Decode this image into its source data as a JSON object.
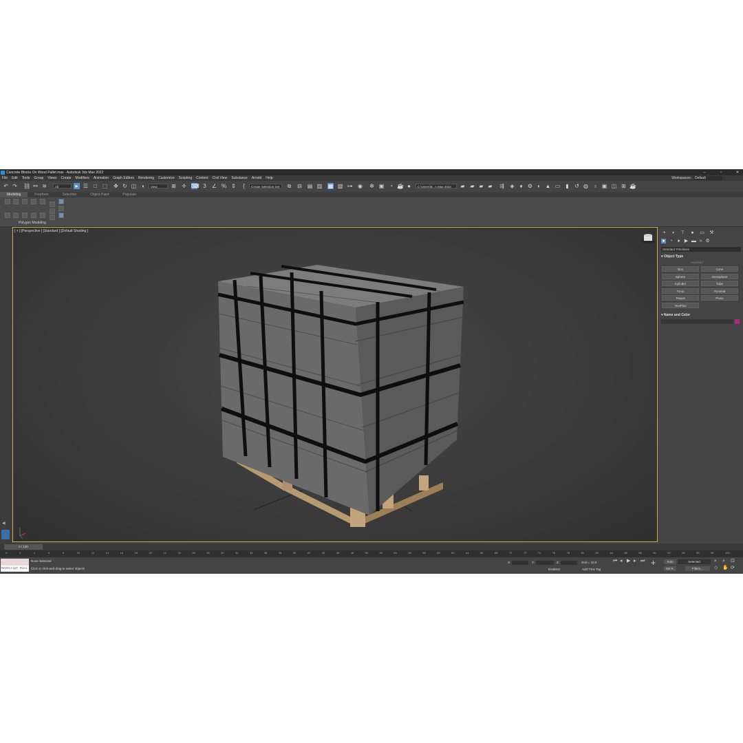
{
  "window": {
    "title": "Concrete Blocks On Wood Pallet.max - Autodesk 3ds Max 2022",
    "workspace_label": "Workspaces:",
    "workspace_value": "Default"
  },
  "menu": [
    "File",
    "Edit",
    "Tools",
    "Group",
    "Views",
    "Create",
    "Modifiers",
    "Animation",
    "Graph Editors",
    "Rendering",
    "Customize",
    "Scripting",
    "Content",
    "Civil View",
    "Substance",
    "Arnold",
    "Help"
  ],
  "toolbar": {
    "filter_value": "All",
    "view_value": "View",
    "selection_set": "Create Selection Set",
    "project_path": "C:\\Users\\B...s Max 2022"
  },
  "ribbon": {
    "tabs": [
      "Modeling",
      "Freeform",
      "Selection",
      "Object Paint",
      "Populate"
    ],
    "panel_label": "Polygon Modeling"
  },
  "viewport": {
    "label": "[ + ] [Perspective ] [Standard ] [Default Shading ]"
  },
  "command_panel": {
    "category": "Standard Primitives",
    "object_type_title": "Object Type",
    "autogrid": "AutoGrid",
    "buttons": [
      "Box",
      "Cone",
      "Sphere",
      "GeoSphere",
      "Cylinder",
      "Tube",
      "Torus",
      "Pyramid",
      "Teapot",
      "Plane",
      "TextPlus"
    ],
    "name_color_title": "Name and Color",
    "swatch_color": "#b0248a"
  },
  "timeline": {
    "frame_display": "0 / 100",
    "ticks": [
      "0",
      "2",
      "6",
      "8",
      "10",
      "12",
      "14",
      "16",
      "18",
      "20",
      "22",
      "24",
      "26",
      "28",
      "30",
      "32",
      "34",
      "36",
      "38",
      "40",
      "42",
      "44",
      "46",
      "48",
      "50",
      "52",
      "54",
      "56",
      "58",
      "60",
      "62",
      "64",
      "66",
      "68",
      "70",
      "72",
      "74",
      "76",
      "78",
      "80",
      "82",
      "84",
      "86",
      "88",
      "90",
      "92",
      "94",
      "96",
      "98",
      "100"
    ]
  },
  "status": {
    "maxscript": "MAXScript Mini",
    "selection": "None Selected",
    "prompt": "Click or click-and-drag to select objects",
    "x_label": "X:",
    "y_label": "Y:",
    "z_label": "Z:",
    "grid": "Grid = 10,0",
    "enabled": "Enabled:",
    "add_time_tag": "Add Time Tag",
    "auto": "Auto",
    "selected": "Selected",
    "set_k": "Set K.",
    "filters": "Filters..."
  }
}
